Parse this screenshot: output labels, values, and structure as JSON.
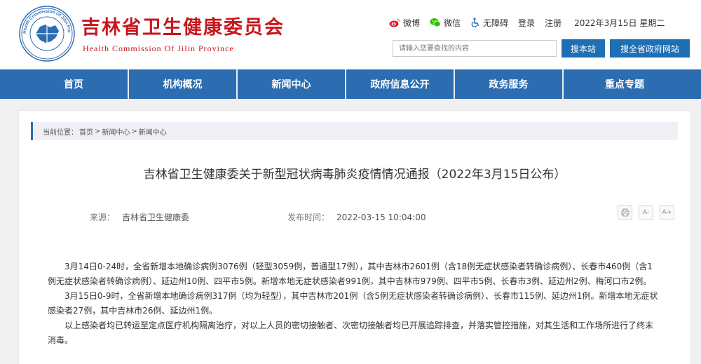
{
  "header": {
    "title": "吉林省卫生健康委员会",
    "subtitle": "Health Commission Of Jilin Province",
    "logo_text": "Health Commission Of Jilin Province",
    "toplinks": {
      "weibo": "微博",
      "wechat": "微信",
      "accessibility": "无障碍",
      "login": "登录",
      "register": "注册",
      "date": "2022年3月15日 星期二"
    },
    "search": {
      "placeholder": "请输入您要查找的内容",
      "site_button": "搜本站",
      "gov_button": "搜全省政府网站"
    },
    "colors": {
      "brand_red": "#c8161d",
      "nav_blue": "#2c6db1",
      "button_blue": "#1f6fb5"
    }
  },
  "nav": {
    "items": [
      "首页",
      "机构概况",
      "新闻中心",
      "政府信息公开",
      "政务服务",
      "重点专题"
    ]
  },
  "breadcrumb": {
    "label": "当前位置：",
    "items": [
      "首页",
      "新闻中心",
      "新闻中心"
    ],
    "separator": ">"
  },
  "article": {
    "title": "吉林省卫生健康委关于新型冠状病毒肺炎疫情情况通报（2022年3月15日公布）",
    "source_label": "来源：",
    "source": "吉林省卫生健康委",
    "time_label": "发布时间：",
    "time": "2022-03-15 10:04:00",
    "tools": {
      "small_font": "A-",
      "large_font": "A+"
    },
    "paragraphs": [
      "3月14日0-24时，全省新增本地确诊病例3076例（轻型3059例，普通型17例），其中吉林市2601例（含18例无症状感染者转确诊病例）、长春市460例（含1例无症状感染者转确诊病例）、延边州10例、四平市5例。新增本地无症状感染者991例，其中吉林市979例、四平市5例、长春市3例、延边州2例、梅河口市2例。",
      "3月15日0-9时，全省新增本地确诊病例317例（均为轻型），其中吉林市201例（含5例无症状感染者转确诊病例）、长春市115例、延边州1例。新增本地无症状感染者27例，其中吉林市26例、延边州1例。",
      "以上感染者均已转运至定点医疗机构隔离治疗，对以上人员的密切接触者、次密切接触者均已开展追踪排查，并落实管控措施，对其生活和工作场所进行了终末消毒。"
    ]
  }
}
